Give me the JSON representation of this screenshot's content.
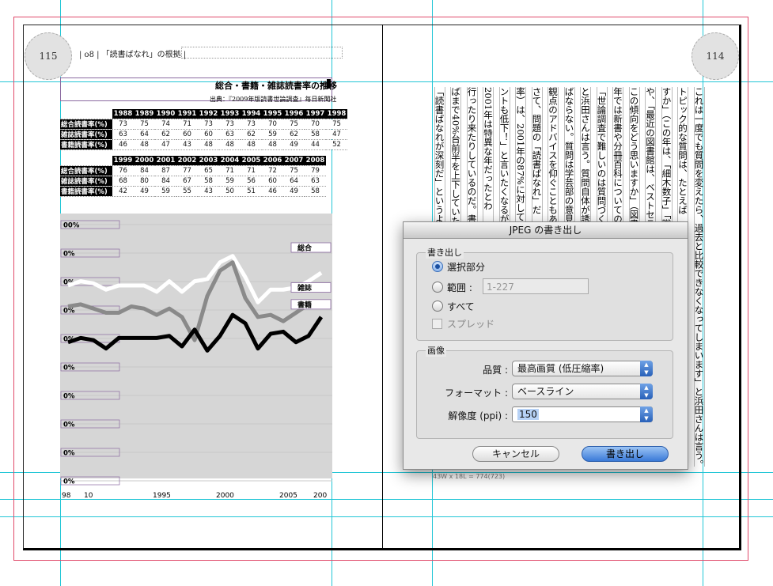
{
  "left_page": {
    "folio": "115",
    "header": "| o8 | 「読書ばなれ」の根拠 |",
    "table": {
      "title": "総合・書籍・雑誌読書率の推移",
      "source": "出典：『2009年版読書世論調査』毎日新聞社",
      "block1": {
        "years": [
          "1988",
          "1989",
          "1990",
          "1991",
          "1992",
          "1993",
          "1994",
          "1995",
          "1996",
          "1997",
          "1998"
        ],
        "rows": [
          {
            "label": "総合読書率(%)",
            "values": [
              "73",
              "75",
              "74",
              "71",
              "73",
              "73",
              "73",
              "70",
              "75",
              "70",
              "75"
            ]
          },
          {
            "label": "雑誌読書率(%)",
            "values": [
              "63",
              "64",
              "62",
              "60",
              "60",
              "63",
              "62",
              "59",
              "62",
              "58",
              "47"
            ]
          },
          {
            "label": "書籍読書率(%)",
            "values": [
              "46",
              "48",
              "47",
              "43",
              "48",
              "48",
              "48",
              "48",
              "49",
              "44",
              "52"
            ]
          }
        ]
      },
      "block2": {
        "years": [
          "1999",
          "2000",
          "2001",
          "2002",
          "2003",
          "2004",
          "2005",
          "2006",
          "2007",
          "2008"
        ],
        "rows": [
          {
            "label": "総合読書率(%)",
            "values": [
              "76",
              "84",
              "87",
              "77",
              "65",
              "71",
              "71",
              "72",
              "75",
              "79"
            ]
          },
          {
            "label": "雑誌読書率(%)",
            "values": [
              "68",
              "80",
              "84",
              "67",
              "58",
              "59",
              "56",
              "60",
              "64",
              "63"
            ]
          },
          {
            "label": "書籍読書率(%)",
            "values": [
              "42",
              "49",
              "59",
              "55",
              "43",
              "50",
              "51",
              "46",
              "49",
              "58"
            ]
          }
        ]
      }
    }
  },
  "chart_data": {
    "type": "line",
    "x": [
      1988,
      1989,
      1990,
      1991,
      1992,
      1993,
      1994,
      1995,
      1996,
      1997,
      1998,
      1999,
      2000,
      2001,
      2002,
      2003,
      2004,
      2005,
      2006,
      2007,
      2008
    ],
    "series": [
      {
        "name": "総合",
        "color": "#ffffff",
        "values": [
          73,
          75,
          74,
          71,
          73,
          73,
          73,
          70,
          75,
          70,
          75,
          76,
          84,
          87,
          77,
          65,
          71,
          71,
          72,
          75,
          79
        ]
      },
      {
        "name": "雑誌",
        "color": "#8a8a8a",
        "values": [
          63,
          64,
          62,
          60,
          60,
          63,
          62,
          59,
          62,
          58,
          47,
          68,
          80,
          84,
          67,
          58,
          59,
          56,
          60,
          64,
          63
        ]
      },
      {
        "name": "書籍",
        "color": "#000000",
        "values": [
          46,
          48,
          47,
          43,
          48,
          48,
          48,
          48,
          49,
          44,
          52,
          42,
          49,
          59,
          55,
          43,
          50,
          51,
          46,
          49,
          58
        ]
      }
    ],
    "y_tick_labels": [
      "00%",
      "0%",
      "0%",
      "0%",
      "0%",
      "0%",
      "0%",
      "0%",
      "0%",
      "0%"
    ],
    "x_tick_labels": [
      "98",
      "10",
      "1995",
      "2000",
      "2005",
      "200"
    ],
    "ylim": [
      0,
      100
    ],
    "grid": true
  },
  "right_page": {
    "folio": "114",
    "columns": [
      "これは一度でも質問を変えたら、過去と比較できなくなってしまいます」と浜田さんは言う。",
      "トピック的な質問は、たとえば",
      "すか」（この年は、「細木数子」「蹴りたい",
      "や、「最近の図書館は、ベストセラ",
      "この傾向をどう思いますか」（図書",
      "年では新書や分冊百科についての調",
      "「世論調査で難しいのは質問づく",
      "と浜田さんは言う。質問自体が誘導",
      "ばならない。質問は学芸部の意見を",
      "観点のアドバイスを仰ぐこともあ",
      "さて、問題の「読書ばなれ」だ",
      "率）は、2001年の87%に対して",
      "ントも低下！」と言いたくなるが",
      "2001年は特異な年だったとわ",
      "行ったり来たりしているのだ。書籍",
      "ばまで40%台前半を上下していた",
      "「読書ばなれが深刻だ」というよう"
    ]
  },
  "dialog": {
    "title": "JPEG の書き出し",
    "export_group": "書き出し",
    "opt_selection": "選択部分",
    "opt_range": "範囲 :",
    "range_value": "1-227",
    "opt_all": "すべて",
    "opt_spread": "スプレッド",
    "image_group": "画像",
    "quality_label": "品質 :",
    "quality_value": "最高画質 (低圧縮率)",
    "format_label": "フォーマット :",
    "format_value": "ベースライン",
    "resolution_label": "解像度 (ppi) :",
    "resolution_value": "150",
    "cancel": "キャンセル",
    "export": "書き出し"
  },
  "status": {
    "dims": "43W x 18L = 774(723)"
  },
  "colors": {
    "guide": "#22c6d6",
    "bleed": "#e04a6a",
    "accent": "#3a7ad8",
    "chart_bg": "#d6d6d6"
  }
}
